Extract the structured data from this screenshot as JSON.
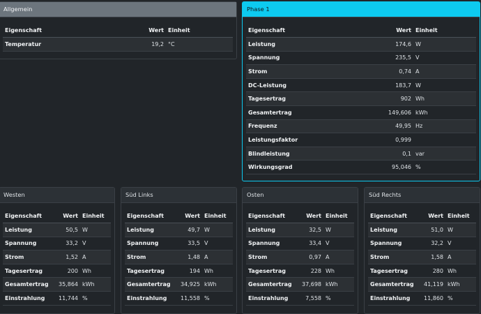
{
  "headers": {
    "property": "Eigenschaft",
    "value": "Wert",
    "unit": "Einheit"
  },
  "allgemein": {
    "title": "Allgemein",
    "rows": [
      {
        "property": "Temperatur",
        "value": "19,2",
        "unit": "°C"
      }
    ]
  },
  "phase1": {
    "title": "Phase 1",
    "rows": [
      {
        "property": "Leistung",
        "value": "174,6",
        "unit": "W"
      },
      {
        "property": "Spannung",
        "value": "235,5",
        "unit": "V"
      },
      {
        "property": "Strom",
        "value": "0,74",
        "unit": "A"
      },
      {
        "property": "DC-Leistung",
        "value": "183,7",
        "unit": "W"
      },
      {
        "property": "Tagesertrag",
        "value": "902",
        "unit": "Wh"
      },
      {
        "property": "Gesamtertrag",
        "value": "149,606",
        "unit": "kWh"
      },
      {
        "property": "Frequenz",
        "value": "49,95",
        "unit": "Hz"
      },
      {
        "property": "Leistungsfaktor",
        "value": "0,999",
        "unit": ""
      },
      {
        "property": "Blindleistung",
        "value": "0,1",
        "unit": "var"
      },
      {
        "property": "Wirkungsgrad",
        "value": "95,046",
        "unit": "%"
      }
    ]
  },
  "westen": {
    "title": "Westen",
    "rows": [
      {
        "property": "Leistung",
        "value": "50,5",
        "unit": "W"
      },
      {
        "property": "Spannung",
        "value": "33,2",
        "unit": "V"
      },
      {
        "property": "Strom",
        "value": "1,52",
        "unit": "A"
      },
      {
        "property": "Tagesertrag",
        "value": "200",
        "unit": "Wh"
      },
      {
        "property": "Gesamtertrag",
        "value": "35,864",
        "unit": "kWh"
      },
      {
        "property": "Einstrahlung",
        "value": "11,744",
        "unit": "%"
      }
    ]
  },
  "suedlinks": {
    "title": "Süd Links",
    "rows": [
      {
        "property": "Leistung",
        "value": "49,7",
        "unit": "W"
      },
      {
        "property": "Spannung",
        "value": "33,5",
        "unit": "V"
      },
      {
        "property": "Strom",
        "value": "1,48",
        "unit": "A"
      },
      {
        "property": "Tagesertrag",
        "value": "194",
        "unit": "Wh"
      },
      {
        "property": "Gesamtertrag",
        "value": "34,925",
        "unit": "kWh"
      },
      {
        "property": "Einstrahlung",
        "value": "11,558",
        "unit": "%"
      }
    ]
  },
  "osten": {
    "title": "Osten",
    "rows": [
      {
        "property": "Leistung",
        "value": "32,5",
        "unit": "W"
      },
      {
        "property": "Spannung",
        "value": "33,4",
        "unit": "V"
      },
      {
        "property": "Strom",
        "value": "0,97",
        "unit": "A"
      },
      {
        "property": "Tagesertrag",
        "value": "228",
        "unit": "Wh"
      },
      {
        "property": "Gesamtertrag",
        "value": "37,698",
        "unit": "kWh"
      },
      {
        "property": "Einstrahlung",
        "value": "7,558",
        "unit": "%"
      }
    ]
  },
  "suedrechts": {
    "title": "Süd Rechts",
    "rows": [
      {
        "property": "Leistung",
        "value": "51,0",
        "unit": "W"
      },
      {
        "property": "Spannung",
        "value": "32,2",
        "unit": "V"
      },
      {
        "property": "Strom",
        "value": "1,58",
        "unit": "A"
      },
      {
        "property": "Tagesertrag",
        "value": "280",
        "unit": "Wh"
      },
      {
        "property": "Gesamtertrag",
        "value": "41,119",
        "unit": "kWh"
      },
      {
        "property": "Einstrahlung",
        "value": "11,860",
        "unit": "%"
      }
    ]
  }
}
